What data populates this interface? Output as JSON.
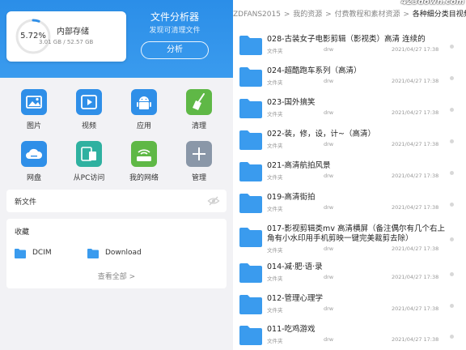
{
  "left": {
    "storage": {
      "percent_label": "5.72%",
      "percent": 0.0572,
      "title": "内部存储",
      "size": "3.01 GB / 52.57 GB"
    },
    "analyzer": {
      "title": "文件分析器",
      "subtitle": "发现可清理文件",
      "button": "分析"
    },
    "grid": [
      {
        "label": "图片",
        "icon": "image-icon",
        "color": "#2f8fe8"
      },
      {
        "label": "视频",
        "icon": "video-icon",
        "color": "#2f8fe8"
      },
      {
        "label": "应用",
        "icon": "android-icon",
        "color": "#2f8fe8"
      },
      {
        "label": "清理",
        "icon": "broom-icon",
        "color": "#5fb846"
      },
      {
        "label": "网盘",
        "icon": "cloud-icon",
        "color": "#2f8fe8"
      },
      {
        "label": "从PC访问",
        "icon": "pc-access-icon",
        "color": "#2fb1a0"
      },
      {
        "label": "我的网络",
        "icon": "router-icon",
        "color": "#5fb846"
      },
      {
        "label": "管理",
        "icon": "plus-icon",
        "color": "#8a97a8"
      }
    ],
    "new_files": {
      "label": "新文件",
      "icon": "eye-off-icon"
    },
    "favorites": {
      "title": "收藏",
      "items": [
        {
          "label": "DCIM",
          "icon": "folder-icon"
        },
        {
          "label": "Download",
          "icon": "folder-icon"
        }
      ],
      "view_all": "查看全部 >"
    }
  },
  "right": {
    "breadcrumb": [
      "ZDFANS2015",
      "我的资源",
      "付费教程和素材资源",
      "各种细分类目视频"
    ],
    "watermark": "423down.com",
    "rows": [
      {
        "name": "028-古装女子电影剪辑（影视类）高清  连续的",
        "type": "文件夹",
        "perm": "drw",
        "date": "2021/04/27 17:38"
      },
      {
        "name": "024-超酷跑车系列（高清）",
        "type": "文件夹",
        "perm": "drw",
        "date": "2021/04/27 17:38"
      },
      {
        "name": "023-国外搞笑",
        "type": "文件夹",
        "perm": "drw",
        "date": "2021/04/27 17:38"
      },
      {
        "name": "022-装，修，设，计~（高清）",
        "type": "文件夹",
        "perm": "drw",
        "date": "2021/04/27 17:38"
      },
      {
        "name": "021-高清航拍风景",
        "type": "文件夹",
        "perm": "drw",
        "date": "2021/04/27 17:38"
      },
      {
        "name": "019-高清街拍",
        "type": "文件夹",
        "perm": "drw",
        "date": "2021/04/27 17:38"
      },
      {
        "name": "017-影视剪辑类mv 高清横屏（备注偶尔有几个右上角有小水印用手机剪映一键完美裁剪去除）",
        "type": "文件夹",
        "perm": "drw",
        "date": "2021/04/27 17:38"
      },
      {
        "name": "014-减·肥·语·录",
        "type": "文件夹",
        "perm": "drw",
        "date": "2021/04/27 17:38"
      },
      {
        "name": "012-管理心理学",
        "type": "文件夹",
        "perm": "drw",
        "date": "2021/04/27 17:38"
      },
      {
        "name": "011-吃鸡游戏",
        "type": "文件夹",
        "perm": "drw",
        "date": "2021/04/27 17:38"
      }
    ]
  }
}
